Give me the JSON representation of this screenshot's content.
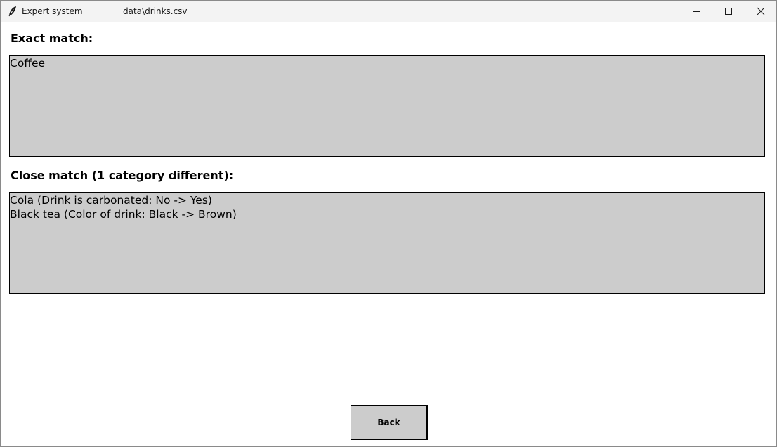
{
  "window": {
    "app_title": "Expert system",
    "file_path": "data\\drinks.csv",
    "icon": "feather-icon",
    "controls": {
      "minimize_icon": "minimize-icon",
      "maximize_icon": "maximize-icon",
      "close_icon": "close-icon"
    }
  },
  "exact": {
    "label": "Exact match:",
    "lines": [
      "Coffee"
    ]
  },
  "close": {
    "label": "Close match (1 category different):",
    "lines": [
      "Cola (Drink is carbonated: No -> Yes)",
      "Black tea (Color of drink: Black -> Brown)"
    ]
  },
  "back_button": {
    "label": "Back"
  },
  "colors": {
    "titlebar_bg": "#f3f3f3",
    "textbox_bg": "#cccccc",
    "button_bg": "#cccccc"
  }
}
